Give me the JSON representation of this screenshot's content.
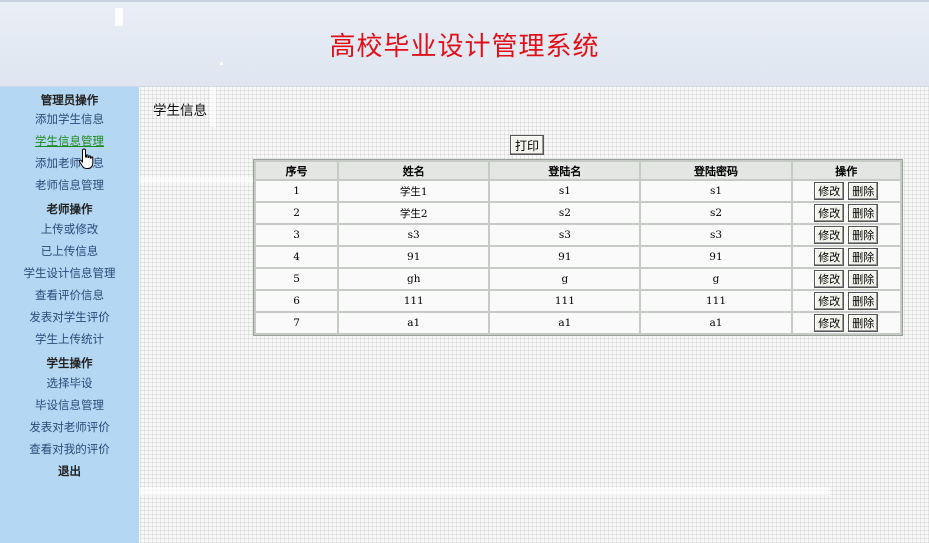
{
  "header": {
    "title": "高校毕业设计管理系统"
  },
  "sidebar": {
    "sections": [
      {
        "heading": "管理员操作",
        "items": [
          "添加学生信息",
          "学生信息管理",
          "添加老师信息",
          "老师信息管理"
        ]
      },
      {
        "heading": "老师操作",
        "items": [
          "上传或修改",
          "已上传信息",
          "学生设计信息管理",
          "查看评价信息",
          "发表对学生评价",
          "学生上传统计"
        ]
      },
      {
        "heading": "学生操作",
        "items": [
          "选择毕设",
          "毕设信息管理",
          "发表对老师评价",
          "查看对我的评价"
        ]
      }
    ],
    "logout": "退出",
    "active_item": "学生信息管理"
  },
  "main": {
    "heading": "学生信息",
    "print_label": "打印",
    "table": {
      "columns": [
        "序号",
        "姓名",
        "登陆名",
        "登陆密码",
        "操作"
      ],
      "rows": [
        {
          "no": "1",
          "name": "学生1",
          "login": "s1",
          "password": "s1"
        },
        {
          "no": "2",
          "name": "学生2",
          "login": "s2",
          "password": "s2"
        },
        {
          "no": "3",
          "name": "s3",
          "login": "s3",
          "password": "s3"
        },
        {
          "no": "4",
          "name": "91",
          "login": "91",
          "password": "91"
        },
        {
          "no": "5",
          "name": "gh",
          "login": "g",
          "password": "g"
        },
        {
          "no": "6",
          "name": "111",
          "login": "111",
          "password": "111"
        },
        {
          "no": "7",
          "name": "a1",
          "login": "a1",
          "password": "a1"
        }
      ],
      "edit_label": "修改",
      "delete_label": "删除"
    }
  },
  "colors": {
    "title": "#e0101a",
    "sidebar_bg": "#b4d7f3",
    "active_link": "#1d8a1d",
    "link": "#2b4b78"
  },
  "icons": [
    "hand-pointer-icon"
  ]
}
